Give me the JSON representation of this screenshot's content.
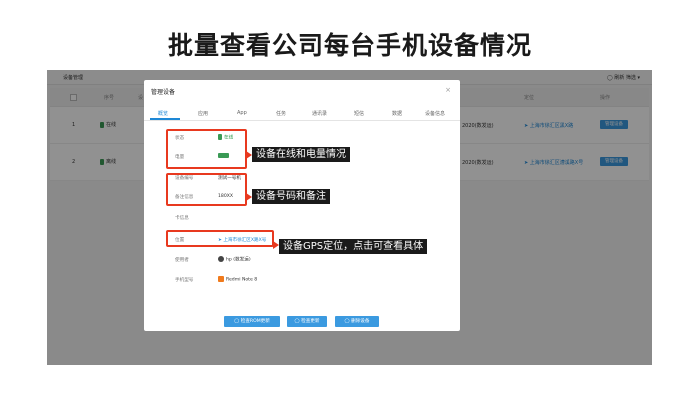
{
  "page_title": "批量查看公司每台手机设备情况",
  "topbar": {
    "title": "设备管理",
    "right": "◯ 刷新    筛选 ▾"
  },
  "table": {
    "headers": {
      "check": "",
      "index": "序号",
      "device": "设",
      "location": "定位",
      "actions": "操作"
    },
    "rows": [
      {
        "index": "1",
        "device": "在线",
        "mid": "2020(数发运)",
        "location": "上海市徐汇区黑X路",
        "action": "管理设备"
      },
      {
        "index": "2",
        "device": "离线",
        "mid": "2020(数发运)",
        "location": "上海市徐汇区漕溪路X号",
        "action": "管理设备"
      }
    ]
  },
  "modal": {
    "title": "管理设备",
    "close": "×",
    "tabs": [
      "概览",
      "应用",
      "App",
      "任务",
      "通讯录",
      "短信",
      "数据",
      "设备信息"
    ],
    "fields": [
      {
        "label": "状态",
        "value": "在线"
      },
      {
        "label": "电量",
        "value": ""
      },
      {
        "label": "设备编号",
        "value": "测试一号机"
      },
      {
        "label": "备注信息",
        "value": "180XX"
      },
      {
        "label": "卡信息",
        "value": ""
      },
      {
        "label": "位置",
        "value": "上海市徐汇区X路X号"
      },
      {
        "label": "使用者",
        "value": "hp  (数发运)"
      },
      {
        "label": "手机型号",
        "value": "Redmi Note 8"
      }
    ],
    "buttons": [
      "◯ 检查ROM更新",
      "◯ 检查更新",
      "◯ 删除设备"
    ]
  },
  "annotations": [
    "设备在线和电量情况",
    "设备号码和备注",
    "设备GPS定位，点击可查看具体"
  ],
  "colors": {
    "accent": "#1e88d6",
    "callout": "#e8391f",
    "online": "#2e9a4c"
  }
}
